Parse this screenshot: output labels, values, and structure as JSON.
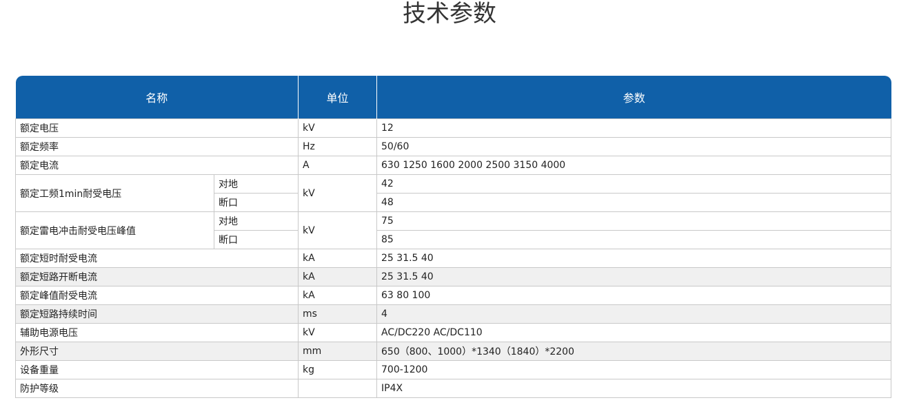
{
  "title": "技术参数",
  "header": {
    "name": "名称",
    "unit": "单位",
    "params": "参数"
  },
  "rows": {
    "r1": {
      "name": "额定电压",
      "unit": "kV",
      "value": "12"
    },
    "r2": {
      "name": "额定频率",
      "unit": "Hz",
      "value": "50/60"
    },
    "r3": {
      "name": "额定电流",
      "unit": "A",
      "value": "630 1250 1600 2000 2500 3150 4000"
    },
    "r4": {
      "name": "额定工频1min耐受电压",
      "sub1": "对地",
      "sub2": "断口",
      "unit": "kV",
      "value1": "42",
      "value2": "48"
    },
    "r5": {
      "name": "额定雷电冲击耐受电压峰值",
      "sub1": "对地",
      "sub2": "断口",
      "unit": "kV",
      "value1": "75",
      "value2": "85"
    },
    "r6": {
      "name": "额定短时耐受电流",
      "unit": "kA",
      "value": "25 31.5 40"
    },
    "r7": {
      "name": "额定短路开断电流",
      "unit": "kA",
      "value": "25 31.5 40"
    },
    "r8": {
      "name": "额定峰值耐受电流",
      "unit": "kA",
      "value": "63 80 100"
    },
    "r9": {
      "name": "额定短路持续时间",
      "unit": "ms",
      "value": "4"
    },
    "r10": {
      "name": "辅助电源电压",
      "unit": "kV",
      "value": "AC/DC220 AC/DC110"
    },
    "r11": {
      "name": "外形尺寸",
      "unit": "mm",
      "value": "650（800、1000）*1340（1840）*2200"
    },
    "r12": {
      "name": "设备重量",
      "unit": "kg",
      "value": "700-1200"
    },
    "r13": {
      "name": "防护等级",
      "unit": "",
      "value": "IP4X"
    }
  }
}
